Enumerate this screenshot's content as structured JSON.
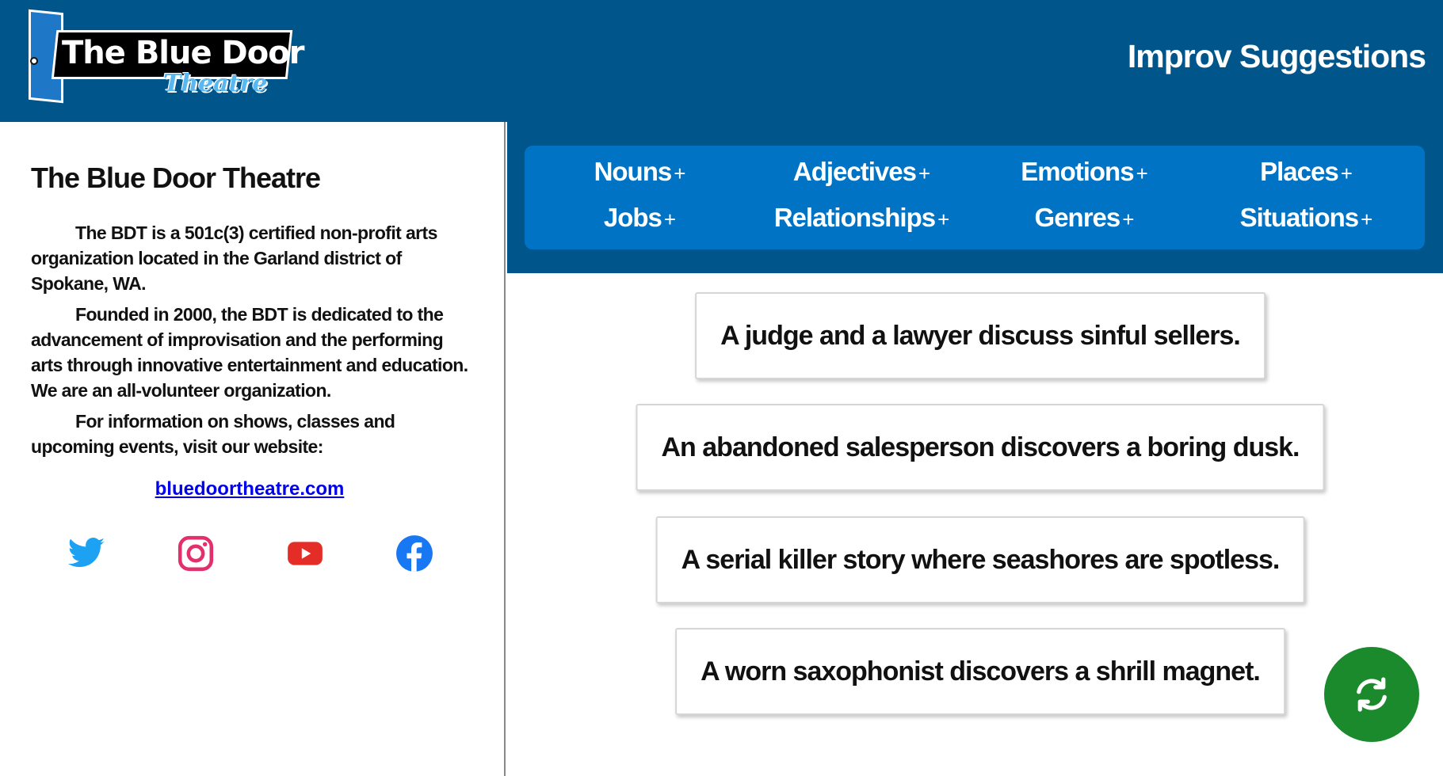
{
  "header": {
    "logo": {
      "title": "The Blue Door",
      "subtitle": "Theatre"
    },
    "title": "Improv Suggestions"
  },
  "sidebar": {
    "heading": "The Blue Door Theatre",
    "paragraphs": [
      "The BDT is a 501c(3) certified non-profit arts organization located in the Garland district of Spokane, WA.",
      "Founded in 2000, the BDT is dedicated to the advancement of improvisation and the performing arts through innovative entertainment and education. We are an all-volunteer organization.",
      "For information on shows, classes and upcoming events, visit our website:"
    ],
    "link": "bluedoortheatre.com",
    "social": [
      {
        "icon": "twitter-icon",
        "color": "#1da1f2"
      },
      {
        "icon": "instagram-icon",
        "color": "#e1306c"
      },
      {
        "icon": "youtube-icon",
        "color": "#e52d27"
      },
      {
        "icon": "facebook-icon",
        "color": "#1877f2"
      }
    ]
  },
  "categories": [
    {
      "label": "Nouns",
      "plus": "+"
    },
    {
      "label": "Adjectives",
      "plus": "+"
    },
    {
      "label": "Emotions",
      "plus": "+"
    },
    {
      "label": "Places",
      "plus": "+"
    },
    {
      "label": "Jobs",
      "plus": "+"
    },
    {
      "label": "Relationships",
      "plus": "+"
    },
    {
      "label": "Genres",
      "plus": "+"
    },
    {
      "label": "Situations",
      "plus": "+"
    }
  ],
  "suggestions": [
    "A judge and a lawyer discuss sinful sellers.",
    "An abandoned salesperson discovers a boring dusk.",
    "A serial killer story where seashores are spotless.",
    "A worn saxophonist discovers a shrill magnet."
  ],
  "refresh_button": {
    "icon": "refresh-icon",
    "color": "#1a8a2c"
  },
  "colors": {
    "header_bg": "#00558a",
    "category_bg": "#0073c4",
    "link": "#0000ee"
  }
}
